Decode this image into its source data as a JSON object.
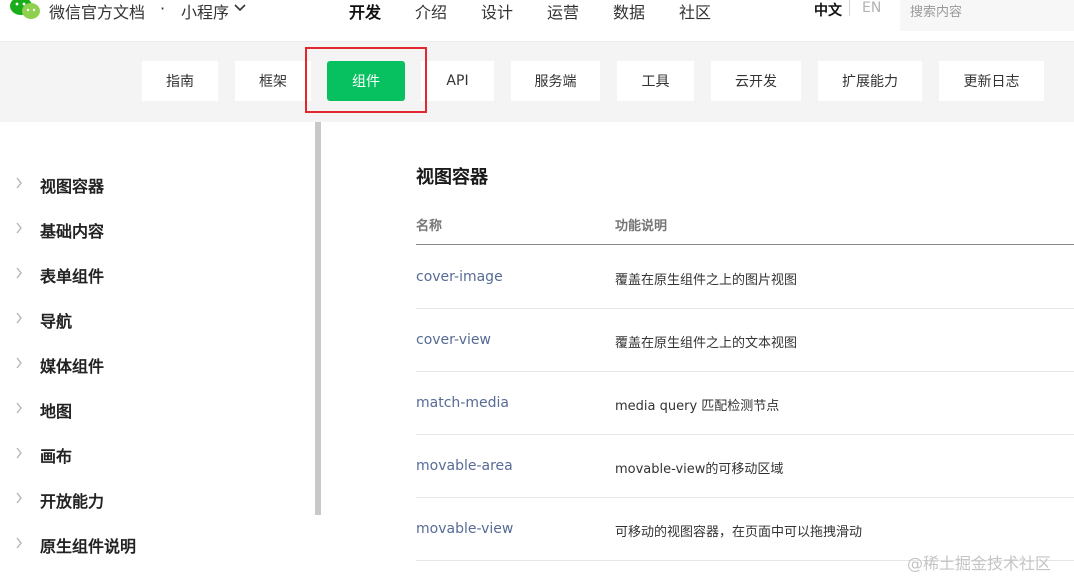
{
  "header": {
    "site_title": "微信官方文档",
    "separator": "·",
    "product": "小程序",
    "nav": [
      "开发",
      "介绍",
      "设计",
      "运营",
      "数据",
      "社区"
    ],
    "nav_active": "开发",
    "lang_zh": "中文",
    "lang_en": "EN",
    "search_placeholder": "搜索内容"
  },
  "subtabs": {
    "items": [
      "指南",
      "框架",
      "组件",
      "API",
      "服务端",
      "工具",
      "云开发",
      "扩展能力",
      "更新日志"
    ],
    "active": "组件"
  },
  "sidebar": {
    "items": [
      "视图容器",
      "基础内容",
      "表单组件",
      "导航",
      "媒体组件",
      "地图",
      "画布",
      "开放能力",
      "原生组件说明"
    ]
  },
  "main": {
    "section_title": "视图容器",
    "columns": [
      "名称",
      "功能说明"
    ],
    "rows": [
      {
        "name": "cover-image",
        "desc": "覆盖在原生组件之上的图片视图"
      },
      {
        "name": "cover-view",
        "desc": "覆盖在原生组件之上的文本视图"
      },
      {
        "name": "match-media",
        "desc": "media query 匹配检测节点"
      },
      {
        "name": "movable-area",
        "desc": "movable-view的可移动区域"
      },
      {
        "name": "movable-view",
        "desc": "可移动的视图容器，在页面中可以拖拽滑动"
      }
    ]
  },
  "watermark": "@稀土掘金技术社区",
  "colors": {
    "accent_green": "#07c160",
    "link_blue": "#576b95",
    "highlight_red": "#e0282e",
    "subbar_bg": "#f4f4f4"
  },
  "icons": {
    "logo": "wechat-logo-icon",
    "product_dropdown": "chevron-down-icon",
    "sidebar_expand": "chevron-right-icon"
  }
}
